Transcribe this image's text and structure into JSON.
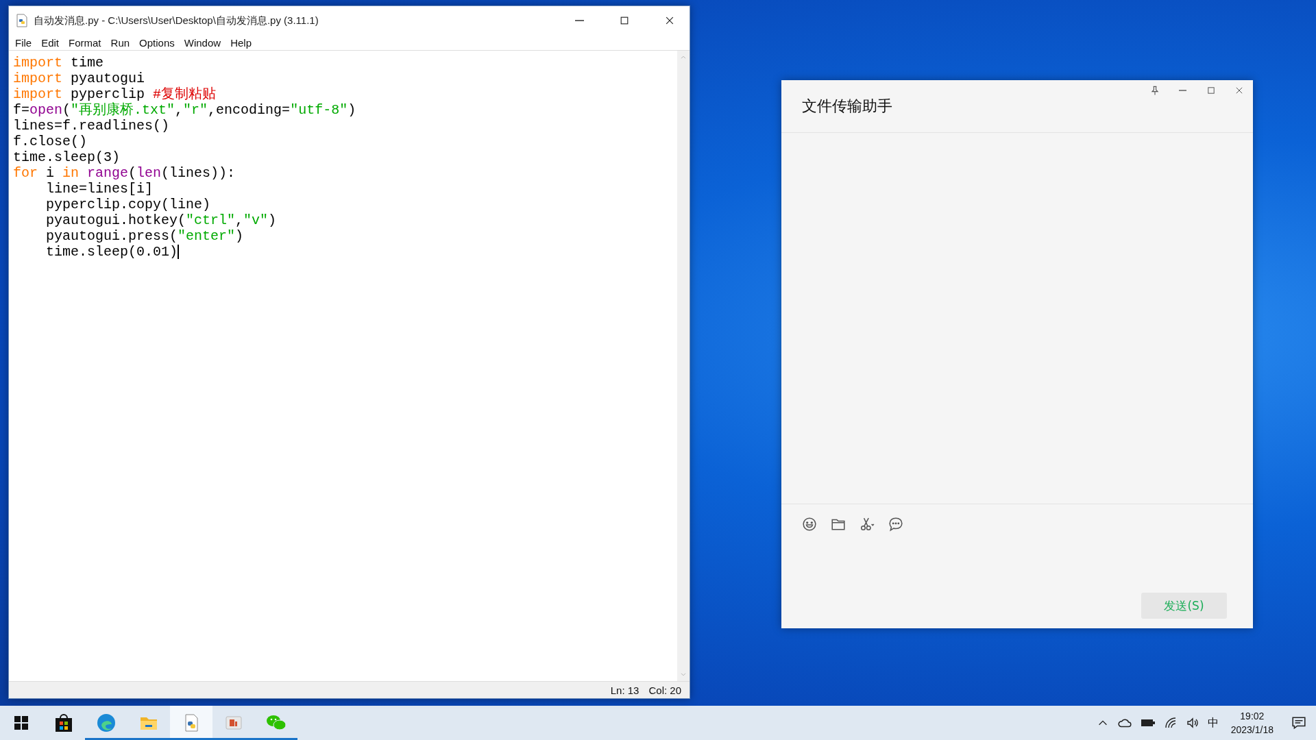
{
  "editor_window": {
    "title": "自动发消息.py - C:\\Users\\User\\Desktop\\自动发消息.py (3.11.1)",
    "menu": [
      "File",
      "Edit",
      "Format",
      "Run",
      "Options",
      "Window",
      "Help"
    ],
    "lines": [
      [
        {
          "kind": "keyword",
          "text": "import"
        },
        {
          "kind": "plain",
          "text": " time"
        }
      ],
      [
        {
          "kind": "keyword",
          "text": "import"
        },
        {
          "kind": "plain",
          "text": " pyautogui"
        }
      ],
      [
        {
          "kind": "keyword",
          "text": "import"
        },
        {
          "kind": "plain",
          "text": " pyperclip "
        },
        {
          "kind": "comment",
          "text": "#复制粘贴"
        }
      ],
      [
        {
          "kind": "plain",
          "text": "f="
        },
        {
          "kind": "builtin",
          "text": "open"
        },
        {
          "kind": "plain",
          "text": "("
        },
        {
          "kind": "string",
          "text": "\"再别康桥.txt\""
        },
        {
          "kind": "plain",
          "text": ","
        },
        {
          "kind": "string",
          "text": "\"r\""
        },
        {
          "kind": "plain",
          "text": ",encoding="
        },
        {
          "kind": "string",
          "text": "\"utf-8\""
        },
        {
          "kind": "plain",
          "text": ")"
        }
      ],
      [
        {
          "kind": "plain",
          "text": "lines=f.readlines()"
        }
      ],
      [
        {
          "kind": "plain",
          "text": "f.close()"
        }
      ],
      [
        {
          "kind": "plain",
          "text": "time.sleep(3)"
        }
      ],
      [
        {
          "kind": "keyword",
          "text": "for"
        },
        {
          "kind": "plain",
          "text": " i "
        },
        {
          "kind": "keyword",
          "text": "in "
        },
        {
          "kind": "builtin",
          "text": "range"
        },
        {
          "kind": "plain",
          "text": "("
        },
        {
          "kind": "builtin",
          "text": "len"
        },
        {
          "kind": "plain",
          "text": "(lines)):"
        }
      ],
      [
        {
          "kind": "plain",
          "text": "    line=lines[i]"
        }
      ],
      [
        {
          "kind": "plain",
          "text": "    pyperclip.copy(line)"
        }
      ],
      [
        {
          "kind": "plain",
          "text": "    pyautogui.hotkey("
        },
        {
          "kind": "string",
          "text": "\"ctrl\""
        },
        {
          "kind": "plain",
          "text": ","
        },
        {
          "kind": "string",
          "text": "\"v\""
        },
        {
          "kind": "plain",
          "text": ")"
        }
      ],
      [
        {
          "kind": "plain",
          "text": "    pyautogui.press("
        },
        {
          "kind": "string",
          "text": "\"enter\""
        },
        {
          "kind": "plain",
          "text": ")"
        }
      ],
      [
        {
          "kind": "plain",
          "text": "    time.sleep(0.01)"
        }
      ]
    ],
    "status": [
      "Ln: 13",
      "Col: 20"
    ]
  },
  "chat_window": {
    "title": "文件传输助手",
    "send_button": "发送(S)"
  },
  "taskbar": {
    "apps": [
      {
        "kind": "store",
        "running": false,
        "selected": false
      },
      {
        "kind": "edge",
        "running": true,
        "selected": false
      },
      {
        "kind": "explorer",
        "running": true,
        "selected": false
      },
      {
        "kind": "python",
        "running": true,
        "selected": true
      },
      {
        "kind": "slides",
        "running": true,
        "selected": false
      },
      {
        "kind": "chat",
        "running": true,
        "selected": false
      }
    ],
    "ime": "中",
    "time": "19:02",
    "date": "2023/1/18"
  }
}
